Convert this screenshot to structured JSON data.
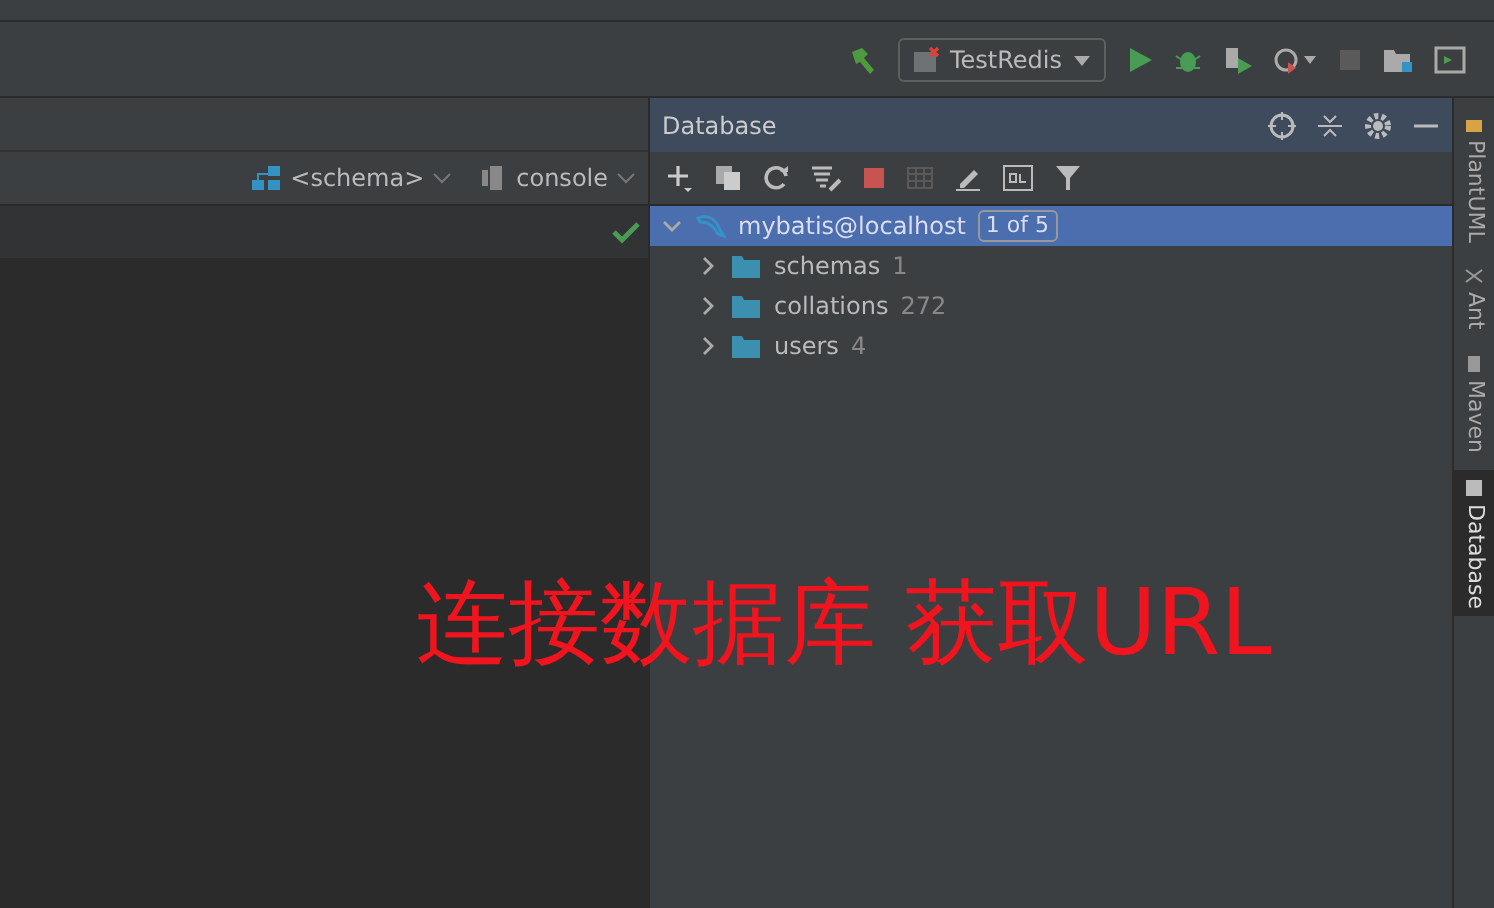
{
  "toolbar": {
    "run_config": "TestRedis"
  },
  "editor": {
    "schema": "<schema>",
    "console": "console"
  },
  "database_panel": {
    "title": "Database",
    "tree": [
      {
        "label": "mybatis@localhost",
        "badge": "1 of 5",
        "selected": true,
        "expanded": true,
        "children": [
          {
            "label": "schemas",
            "count": "1",
            "selected": false,
            "expanded": false
          },
          {
            "label": "collations",
            "count": "272",
            "selected": false,
            "expanded": false
          },
          {
            "label": "users",
            "count": "4",
            "selected": false,
            "expanded": false
          }
        ]
      }
    ]
  },
  "side_tabs": [
    {
      "label": "PlantUML",
      "selected": false
    },
    {
      "label": "Ant",
      "selected": false
    },
    {
      "label": "Maven",
      "selected": false
    },
    {
      "label": "Database",
      "selected": true
    }
  ],
  "annotation": "连接数据库 获取URL"
}
